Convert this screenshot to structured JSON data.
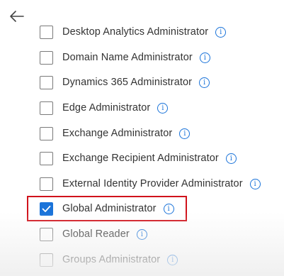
{
  "nav": {
    "back_icon": "arrow-left-icon"
  },
  "roles": [
    {
      "label": "Desktop Analytics Administrator",
      "checked": false
    },
    {
      "label": "Domain Name Administrator",
      "checked": false
    },
    {
      "label": "Dynamics 365 Administrator",
      "checked": false
    },
    {
      "label": "Edge Administrator",
      "checked": false
    },
    {
      "label": "Exchange Administrator",
      "checked": false
    },
    {
      "label": "Exchange Recipient Administrator",
      "checked": false
    },
    {
      "label": "External Identity Provider Administrator",
      "checked": false
    },
    {
      "label": "Global Administrator",
      "checked": true
    },
    {
      "label": "Global Reader",
      "checked": false
    },
    {
      "label": "Groups Administrator",
      "checked": false
    }
  ],
  "info_glyph": "i",
  "colors": {
    "accent": "#1a73d9",
    "highlight": "#d0121b",
    "text": "#333333"
  }
}
